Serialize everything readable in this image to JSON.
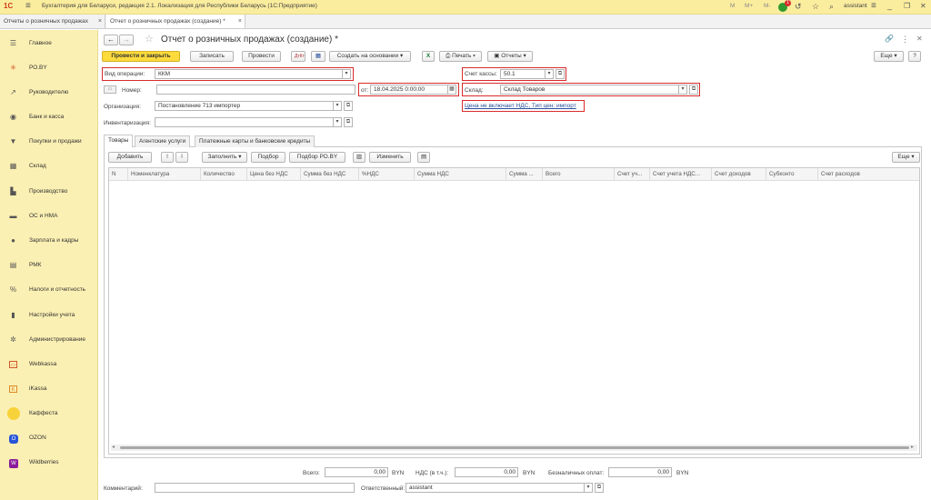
{
  "titlebar": {
    "logo": "1С",
    "title": "Бухгалтерия для Беларуси, редакция 2.1. Локализация для Республики Беларусь  (1С:Предприятие)",
    "m1": "M",
    "m2": "M+",
    "m3": "M-",
    "notif_count": "1",
    "user": "assistant"
  },
  "window_tabs": [
    {
      "label": "Отчеты о розничных продажах"
    },
    {
      "label": "Отчет о розничных продажах (создание) *"
    }
  ],
  "sidebar": {
    "items": [
      {
        "label": "Главное",
        "icon": "menu-icon"
      },
      {
        "label": "РО.BY",
        "icon": "ro-by-icon"
      },
      {
        "label": "Руководителю",
        "icon": "chart-line-icon"
      },
      {
        "label": "Банк и касса",
        "icon": "bank-icon"
      },
      {
        "label": "Покупки и продажи",
        "icon": "cart-icon"
      },
      {
        "label": "Склад",
        "icon": "warehouse-icon"
      },
      {
        "label": "Производство",
        "icon": "factory-icon"
      },
      {
        "label": "ОС и НМА",
        "icon": "truck-icon"
      },
      {
        "label": "Зарплата и кадры",
        "icon": "person-icon"
      },
      {
        "label": "РМК",
        "icon": "cashdesk-icon"
      },
      {
        "label": "Налоги и отчетность",
        "icon": "percent-icon"
      },
      {
        "label": "Настройки учета",
        "icon": "book-icon"
      },
      {
        "label": "Администрирование",
        "icon": "gear-icon"
      },
      {
        "label": "Webkassa",
        "icon": "webkassa-icon"
      },
      {
        "label": "iKassa",
        "icon": "ikassa-icon"
      },
      {
        "label": "Каффеста",
        "icon": "kaffesta-icon"
      },
      {
        "label": "OZON",
        "icon": "ozon-icon"
      },
      {
        "label": "Wildberries",
        "icon": "wildberries-icon"
      }
    ]
  },
  "form": {
    "title": "Отчет о розничных продажах (создание) *",
    "toolbar": {
      "post_close": "Провести и закрыть",
      "save": "Записать",
      "post": "Провести",
      "create_based": "Создать на основании",
      "print": "Печать",
      "reports": "Отчеты",
      "more": "Еще",
      "help": "?"
    },
    "operation_label": "Вид операции:",
    "operation_value": "ККМ",
    "number_label": "Номер:",
    "number_value": "",
    "date_label": "от:",
    "date_value": "18.04.2025  0:00:00",
    "org_label": "Организация:",
    "org_value": "Постановление 713 импортер",
    "inventory_label": "Инвентаризация:",
    "inventory_value": "",
    "cash_account_label": "Счет кассы:",
    "cash_account_value": "50.1",
    "warehouse_label": "Склад:",
    "warehouse_value": "Склад Товаров",
    "price_link": "Цена не включает НДС, Тип цен: импорт"
  },
  "tabs": [
    {
      "label": "Товары"
    },
    {
      "label": "Агентские услуги"
    },
    {
      "label": "Платежные карты и банковские кредиты"
    }
  ],
  "table_toolbar": {
    "add": "Добавить",
    "fill": "Заполнить",
    "selection": "Подбор",
    "selection_ro": "Подбор РО.BY",
    "change": "Изменить",
    "more": "Еще"
  },
  "table": {
    "columns": [
      "N",
      "Номенклатура",
      "Количество",
      "Цена без НДС",
      "Сумма без НДС",
      "%НДС",
      "Сумма НДС",
      "Сумма ...",
      "Всего",
      "Счет уч...",
      "Счет учета НДС...",
      "Счет доходов",
      "Субконто",
      "Счет расходов"
    ]
  },
  "footer": {
    "total_label": "Всего:",
    "total_value": "0,00",
    "total_cur": "BYN",
    "vat_label": "НДС (в т.ч.):",
    "vat_value": "0,00",
    "vat_cur": "BYN",
    "cashless_label": "Безналичных оплат:",
    "cashless_value": "0,00",
    "cashless_cur": "BYN",
    "comment_label": "Комментарий:",
    "comment_value": "",
    "responsible_label": "Ответственный:",
    "responsible_value": "assistant"
  },
  "colors": {
    "titlebar": "#fbed9e",
    "sidebar": "#fbf0b3",
    "primary_button": "#fddb3d",
    "highlight_border": "#d92b2b",
    "link": "#2a4f9a"
  }
}
